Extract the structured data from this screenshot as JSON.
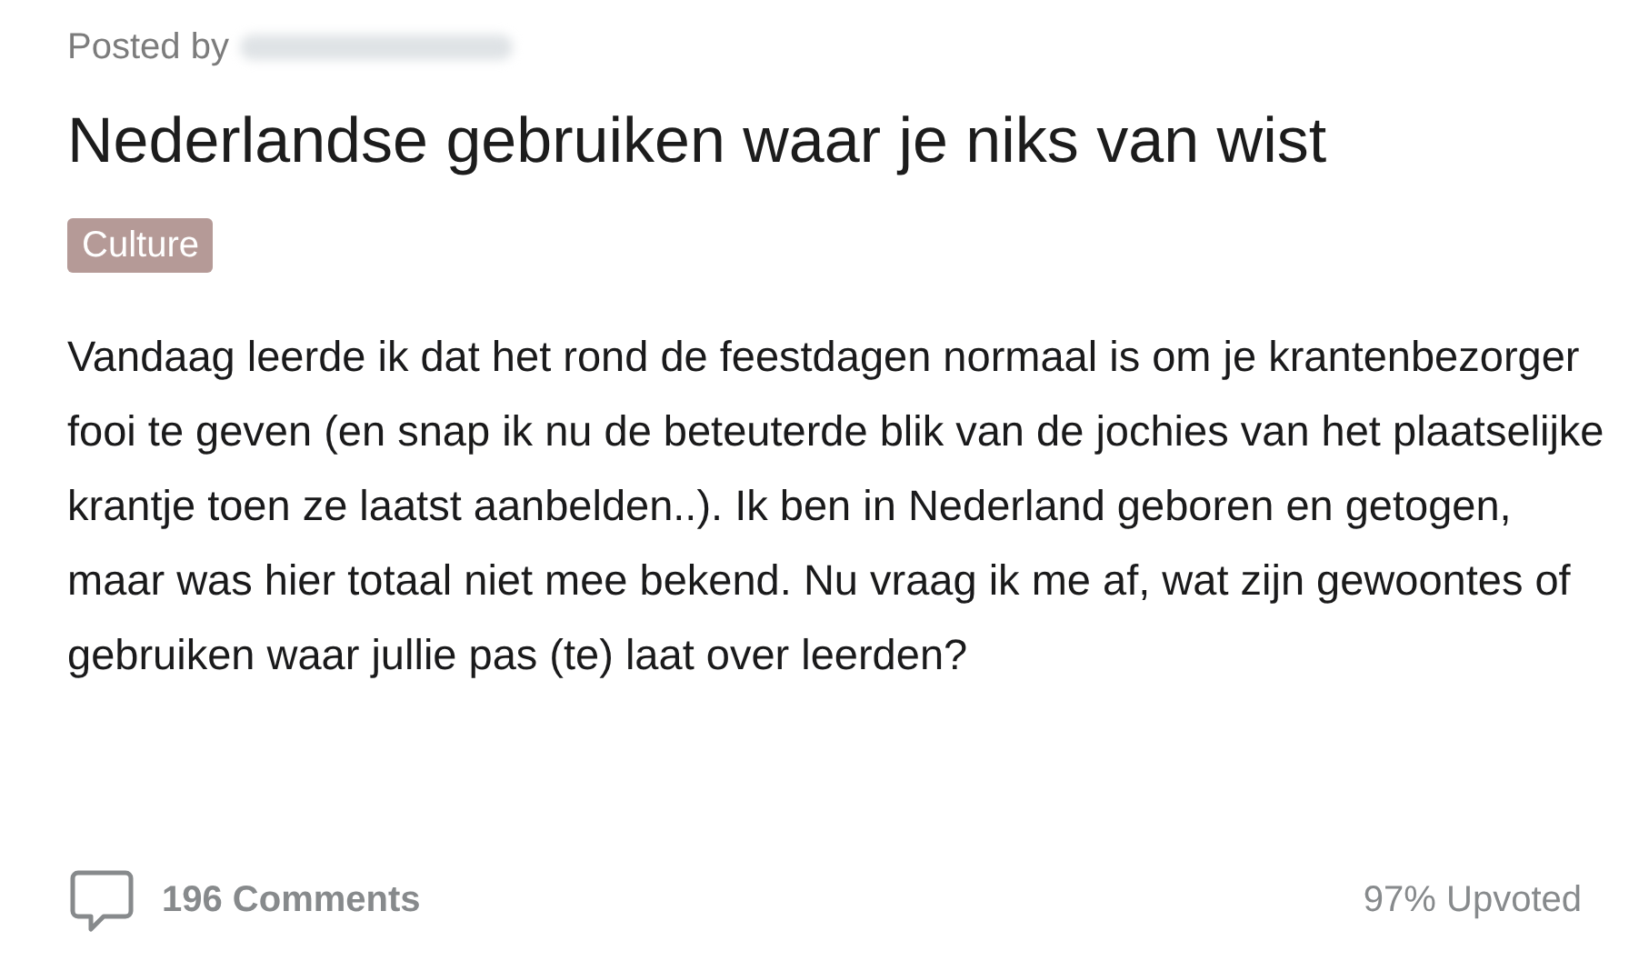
{
  "post": {
    "posted_by_label": "Posted by",
    "title": "Nederlandse gebruiken waar je niks van wist",
    "flair": "Culture",
    "body": "Vandaag leerde ik dat het rond de feestdagen normaal is om je krantenbezorger fooi te geven (en snap ik nu de beteuterde blik van de jochies van het plaatselijke krantje toen ze laatst aanbelden..). Ik ben in Nederland geboren en getogen, maar was hier totaal niet mee bekend. Nu vraag ik me af, wat zijn gewoontes of gebruiken waar jullie pas (te) laat over leerden?",
    "comments": "196 Comments",
    "upvoted": "97% Upvoted"
  }
}
